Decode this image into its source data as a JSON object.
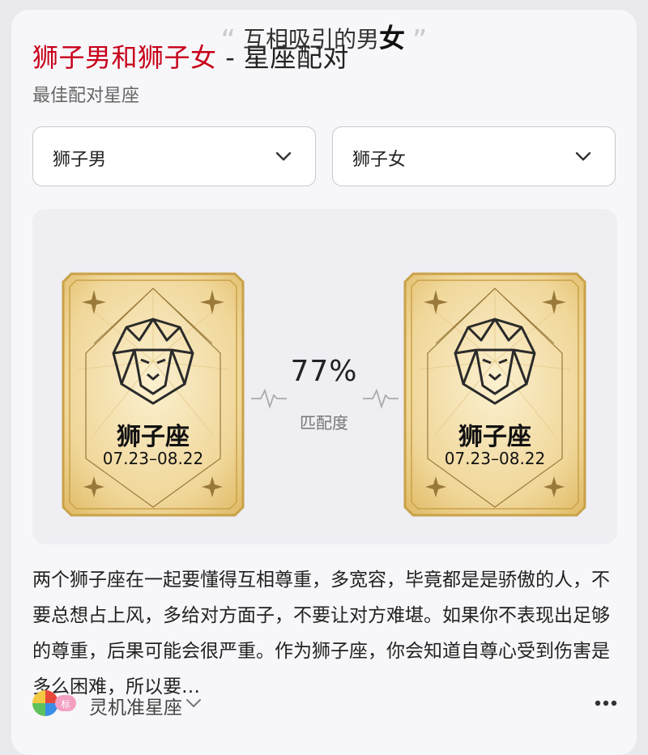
{
  "header": {
    "title_red": "狮子男和狮子女",
    "title_sep": " - ",
    "title_rest": "星座配对",
    "subtitle": "最佳配对星座"
  },
  "selects": {
    "left": {
      "value": "狮子男"
    },
    "right": {
      "value": "狮子女"
    }
  },
  "match": {
    "quote_open": "“",
    "quote_text": "互相吸引的男",
    "quote_strong": "女",
    "quote_close": "”",
    "percent": "77%",
    "percent_label": "匹配度",
    "left_card": {
      "name": "狮子座",
      "dates": "07.23–08.22",
      "icon": "lion-icon"
    },
    "right_card": {
      "name": "狮子座",
      "dates": "07.23–08.22",
      "icon": "lion-icon"
    }
  },
  "description": "两个狮子座在一起要懂得互相尊重，多宽容，毕竟都是是骄傲的人，不要总想占上风，多给对方面子，不要让对方难堪。如果你不表现出足够的尊重，后果可能会很严重。作为狮子座，你会知道自尊心受到伤害是多么困难，所以要…",
  "footer": {
    "source_name": "灵机准星座",
    "logo_icon": "app-logo-icon",
    "more_icon": "more-icon"
  },
  "colors": {
    "accent_red": "#c8001a",
    "card_gold": "#e8c878",
    "card_border": "#c9a24a"
  }
}
